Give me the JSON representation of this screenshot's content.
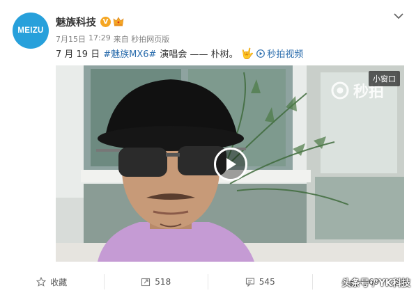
{
  "post": {
    "author": "魅族科技",
    "avatar_text": "MEIZU",
    "verified_badge": "V",
    "date": "7月15日",
    "time": "17:29",
    "source": "来自 秒拍网页版",
    "text_date": "7 月 19 日",
    "hashtag": "#魅族MX6#",
    "text_rest": "演唱会 —— 朴树。",
    "video_link": "秒拍视频"
  },
  "video": {
    "mini_window_label": "小窗口",
    "watermark": "秒拍"
  },
  "actions": {
    "favorite_label": "收藏",
    "repost_count": "518",
    "comment_count": "545",
    "like_count": "569"
  },
  "watermark_overlay": "头条号 / YK科技",
  "colors": {
    "brand_blue": "#27a0db",
    "link_blue": "#2b6dad",
    "badge_orange": "#f5a623"
  }
}
